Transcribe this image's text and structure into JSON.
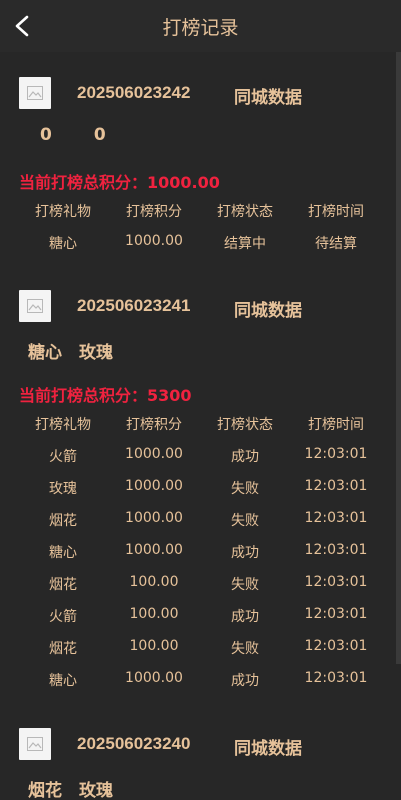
{
  "header": {
    "title": "打榜记录"
  },
  "records": [
    {
      "order_no": "202506023242",
      "tag": "同城数据",
      "gifts": [
        "0",
        "0"
      ],
      "total": "当前打榜总积分：1000.00",
      "columns": [
        "打榜礼物",
        "打榜积分",
        "打榜状态",
        "打榜时间"
      ],
      "rows": [
        [
          "糖心",
          "1000.00",
          "结算中",
          "待结算"
        ]
      ]
    },
    {
      "order_no": "202506023241",
      "tag": "同城数据",
      "gifts": [
        "糖心",
        "玫瑰"
      ],
      "total": "当前打榜总积分：5300",
      "columns": [
        "打榜礼物",
        "打榜积分",
        "打榜状态",
        "打榜时间"
      ],
      "rows": [
        [
          "火箭",
          "1000.00",
          "成功",
          "12:03:01"
        ],
        [
          "玫瑰",
          "1000.00",
          "失败",
          "12:03:01"
        ],
        [
          "烟花",
          "1000.00",
          "失败",
          "12:03:01"
        ],
        [
          "糖心",
          "1000.00",
          "成功",
          "12:03:01"
        ],
        [
          "烟花",
          "100.00",
          "失败",
          "12:03:01"
        ],
        [
          "火箭",
          "100.00",
          "成功",
          "12:03:01"
        ],
        [
          "烟花",
          "100.00",
          "失败",
          "12:03:01"
        ],
        [
          "糖心",
          "1000.00",
          "成功",
          "12:03:01"
        ]
      ]
    },
    {
      "order_no": "202506023240",
      "tag": "同城数据",
      "gifts": [
        "烟花",
        "玫瑰"
      ],
      "total": "",
      "columns": [],
      "rows": []
    }
  ],
  "icons": {
    "back": "chevron-left-icon",
    "thumb": "image-placeholder-icon"
  },
  "colors": {
    "background": "#272727",
    "text": "#e6c29a",
    "total": "#f0223f"
  }
}
